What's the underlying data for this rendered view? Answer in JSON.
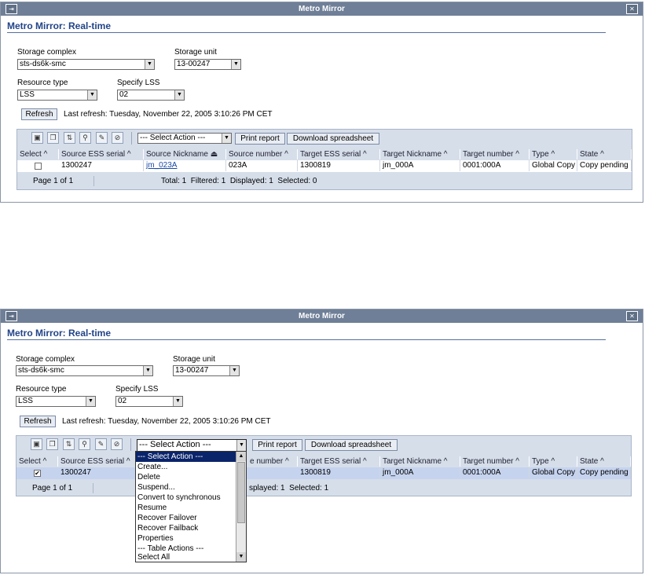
{
  "window": {
    "title": "Metro Mirror",
    "expand_glyph": "⇥",
    "close_glyph": "✕"
  },
  "page": {
    "heading": "Metro Mirror: Real-time"
  },
  "form": {
    "storage_complex_label": "Storage complex",
    "storage_complex_value": "sts-ds6k-smc",
    "storage_unit_label": "Storage unit",
    "storage_unit_value": "13-00247",
    "resource_type_label": "Resource type",
    "resource_type_value": "LSS",
    "specify_lss_label": "Specify LSS",
    "specify_lss_value": "02"
  },
  "refresh": {
    "button": "Refresh",
    "last_refresh": "Last refresh: Tuesday, November 22, 2005 3:10:26 PM CET"
  },
  "toolbar": {
    "icons": [
      "select-all-icon",
      "deselect-all-icon",
      "expand-icon",
      "filter-icon",
      "edit-icon",
      "clear-filter-icon"
    ],
    "action_select": "--- Select Action ---",
    "print_report": "Print report",
    "download_spreadsheet": "Download spreadsheet"
  },
  "table": {
    "columns": [
      "Select ^",
      "Source ESS serial ^",
      "Source Nickname ⏏",
      "Source number ^",
      "Target ESS serial ^",
      "Target Nickname ^",
      "Target number ^",
      "Type ^",
      "State ^"
    ],
    "row": {
      "source_ess_serial": "1300247",
      "source_nickname": "jm_023A",
      "source_number": "023A",
      "target_ess_serial": "1300819",
      "target_nickname": "jm_000A",
      "target_number": "0001:000A",
      "type": "Global Copy",
      "state": "Copy pending"
    },
    "footer": {
      "page": "Page 1 of 1",
      "counts_top": "Total: 1  Filtered: 1  Displayed: 1  Selected: 0",
      "counts_bottom_partial": "splayed: 1  Selected: 1"
    }
  },
  "bottom_partial": {
    "source_number_header": "e number ^"
  },
  "action_menu": {
    "items": [
      "--- Select Action ---",
      "Create...",
      "Delete",
      "Suspend...",
      "Convert to synchronous",
      "Resume",
      "Recover Failover",
      "Recover Failback",
      "Properties",
      "--- Table Actions ---",
      "Select All"
    ]
  },
  "colors": {
    "titlebar": "#6f7f97",
    "heading": "#224488",
    "selected_row": "#c5d3ee",
    "menu_highlight": "#0a246a"
  }
}
